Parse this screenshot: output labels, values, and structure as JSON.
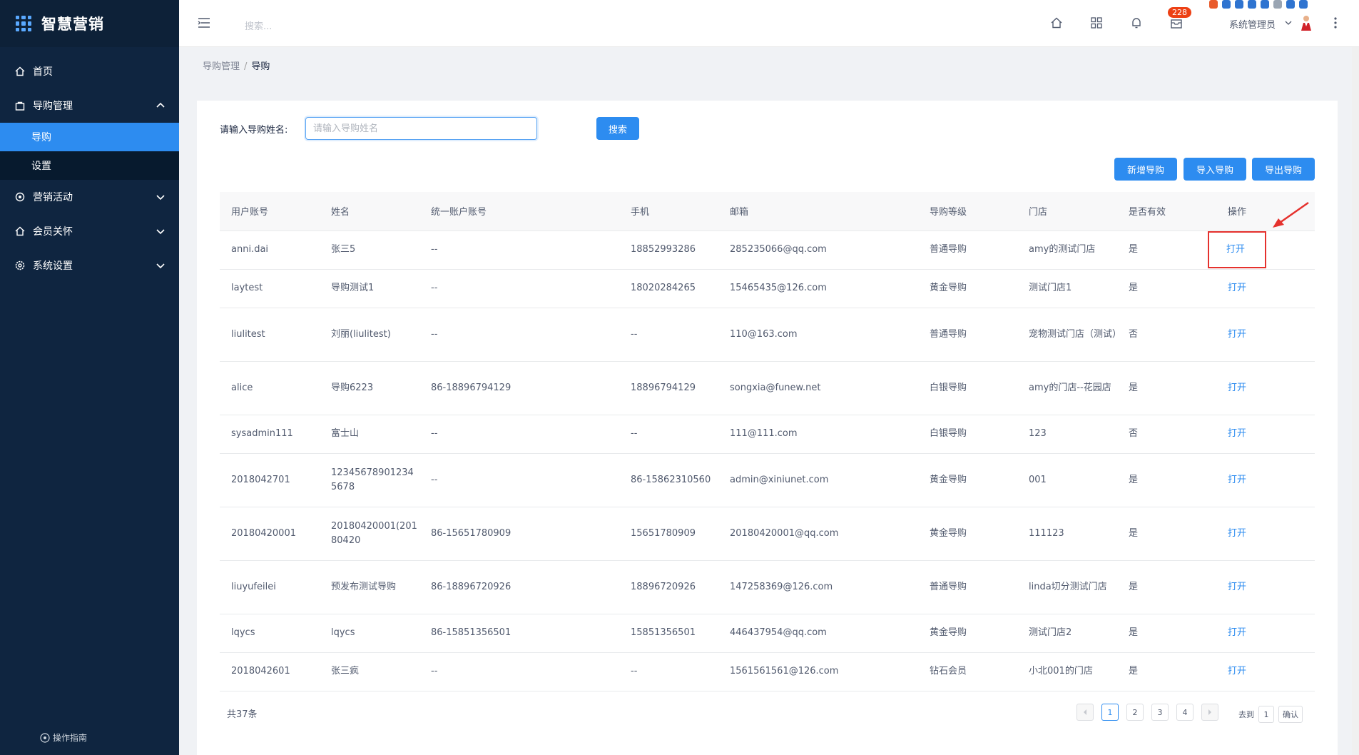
{
  "app": {
    "logo_text": "智慧营销"
  },
  "sidebar": {
    "items": [
      {
        "label": "首页",
        "icon": "home-icon"
      },
      {
        "label": "导购管理",
        "icon": "bag-icon",
        "expanded": true,
        "children": [
          {
            "label": "导购",
            "active": true
          },
          {
            "label": "设置"
          }
        ]
      },
      {
        "label": "营销活动",
        "icon": "target-icon"
      },
      {
        "label": "会员关怀",
        "icon": "home-icon"
      },
      {
        "label": "系统设置",
        "icon": "gear-icon"
      }
    ],
    "guide_label": "操作指南"
  },
  "header": {
    "search_placeholder": "搜索...",
    "badge_count": "228",
    "user_name": "系统管理员"
  },
  "breadcrumb": {
    "parent": "导购管理",
    "separator": "/",
    "current": "导购"
  },
  "search": {
    "label": "请输入导购姓名:",
    "placeholder": "请输入导购姓名",
    "button": "搜索"
  },
  "toolbar": {
    "add": "新增导购",
    "import": "导入导购",
    "export": "导出导购"
  },
  "table": {
    "columns": [
      "用户账号",
      "姓名",
      "统一账户账号",
      "手机",
      "邮箱",
      "导购等级",
      "门店",
      "是否有效",
      "操作"
    ],
    "rows": [
      {
        "account": "anni.dai",
        "name": "张三5",
        "unified": "--",
        "phone": "18852993286",
        "email": "285235066@qq.com",
        "level": "普通导购",
        "store": "amy的测试门店",
        "valid": "是",
        "action": "打开"
      },
      {
        "account": "laytest",
        "name": "导购测试1",
        "unified": "--",
        "phone": "18020284265",
        "email": "15465435@126.com",
        "level": "黄金导购",
        "store": "测试门店1",
        "valid": "是",
        "action": "打开"
      },
      {
        "account": "liulitest",
        "name": "刘丽(liulitest)",
        "unified": "--",
        "phone": "--",
        "email": "110@163.com",
        "level": "普通导购",
        "store": "宠物测试门店（测试）",
        "valid": "否",
        "action": "打开"
      },
      {
        "account": "alice",
        "name": "导购6223",
        "unified": "86-18896794129",
        "phone": "18896794129",
        "email": "songxia@funew.net",
        "level": "白银导购",
        "store": "amy的门店--花园店",
        "valid": "是",
        "action": "打开"
      },
      {
        "account": "sysadmin111",
        "name": "富士山",
        "unified": "--",
        "phone": "--",
        "email": "111@111.com",
        "level": "白银导购",
        "store": "123",
        "valid": "否",
        "action": "打开"
      },
      {
        "account": "2018042701",
        "name": "123456789012345678",
        "unified": "--",
        "phone": "86-15862310560",
        "email": "admin@xiniunet.com",
        "level": "黄金导购",
        "store": "001",
        "valid": "是",
        "action": "打开"
      },
      {
        "account": "20180420001",
        "name": "20180420001(20180420",
        "unified": "86-15651780909",
        "phone": "15651780909",
        "email": "20180420001@qq.com",
        "level": "黄金导购",
        "store": "111123",
        "valid": "是",
        "action": "打开"
      },
      {
        "account": "liuyufeilei",
        "name": "预发布测试导购",
        "unified": "86-18896720926",
        "phone": "18896720926",
        "email": "147258369@126.com",
        "level": "普通导购",
        "store": "linda切分测试门店",
        "valid": "是",
        "action": "打开"
      },
      {
        "account": "lqycs",
        "name": "lqycs",
        "unified": "86-15851356501",
        "phone": "15851356501",
        "email": "446437954@qq.com",
        "level": "黄金导购",
        "store": "测试门店2",
        "valid": "是",
        "action": "打开"
      },
      {
        "account": "2018042601",
        "name": "张三疯",
        "unified": "--",
        "phone": "--",
        "email": "1561561561@126.com",
        "level": "钻石会员",
        "store": "小北001的门店",
        "valid": "是",
        "action": "打开"
      }
    ]
  },
  "pagination": {
    "total_text": "共37条",
    "pages": [
      "1",
      "2",
      "3",
      "4"
    ],
    "current": "1",
    "goto_label": "去到",
    "goto_value": "1",
    "confirm": "确认"
  },
  "colors": {
    "sidebar_bg": "#0f2540",
    "accent": "#2d8cf0",
    "badge": "#ed4014",
    "highlight": "#e5312d"
  }
}
